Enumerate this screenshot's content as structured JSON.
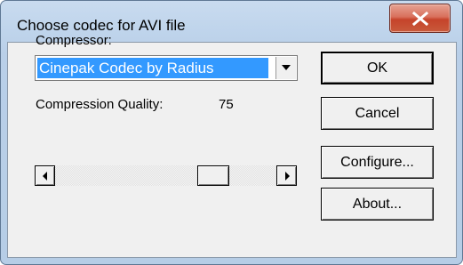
{
  "window": {
    "title": "Choose codec for AVI file",
    "close_glyph": "X"
  },
  "compressor": {
    "label": "Compressor:",
    "selected": "Cinepak Codec by Radius"
  },
  "quality": {
    "label": "Compression Quality:",
    "value": "75",
    "slider_fraction": 0.75
  },
  "buttons": {
    "ok": "OK",
    "cancel": "Cancel",
    "configure": "Configure...",
    "about": "About..."
  },
  "icons": {
    "close": "close-icon",
    "dropdown": "chevron-down-icon",
    "left": "arrow-left-icon",
    "right": "arrow-right-icon"
  },
  "colors": {
    "selection": "#3399ff",
    "close_button": "#c6432a",
    "frame": "#b9cfe8"
  }
}
